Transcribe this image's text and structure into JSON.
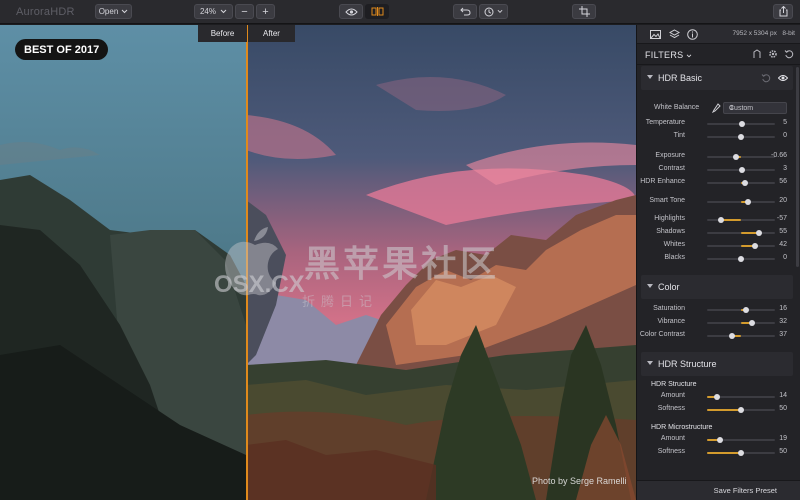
{
  "app": {
    "title": "AuroraHDR"
  },
  "toolbar": {
    "open_label": "Open",
    "zoom_value": "24%",
    "zoom_out_symbol": "−",
    "zoom_in_symbol": "+"
  },
  "canvas": {
    "before_label": "Before",
    "after_label": "After",
    "badge": "BEST OF 2017",
    "photo_credit": "Photo by Serge Ramelli",
    "split_accent_color": "#e08a1c",
    "watermark_logo": {
      "chinese": "黑苹果社区",
      "domain": "OSX.CX",
      "sub": "折腾日记"
    }
  },
  "panel": {
    "image_size": "7952 x 5304 px",
    "bit_depth": "8-bit",
    "filters_title": "FILTERS",
    "accent_color": "#d39b2d",
    "sections": {
      "hdr_basic": {
        "title": "HDR Basic",
        "white_balance_label": "White Balance",
        "white_balance_value": "Custom",
        "rows": [
          {
            "label": "Temperature",
            "value": "5",
            "level": 0.52
          },
          {
            "label": "Tint",
            "value": "0",
            "level": 0.5
          },
          {
            "label": "Exposure",
            "value": "-0.66",
            "level": 0.42
          },
          {
            "label": "Contrast",
            "value": "3",
            "level": 0.51
          },
          {
            "label": "HDR Enhance",
            "value": "56",
            "level": 0.56
          },
          {
            "label": "Smart Tone",
            "value": "20",
            "level": 0.6
          },
          {
            "label": "Highlights",
            "value": "-57",
            "level": 0.21
          },
          {
            "label": "Shadows",
            "value": "55",
            "level": 0.77
          },
          {
            "label": "Whites",
            "value": "42",
            "level": 0.71
          },
          {
            "label": "Blacks",
            "value": "0",
            "level": 0.5
          }
        ]
      },
      "color": {
        "title": "Color",
        "rows": [
          {
            "label": "Saturation",
            "value": "16",
            "level": 0.58
          },
          {
            "label": "Vibrance",
            "value": "32",
            "level": 0.66
          },
          {
            "label": "Color Contrast",
            "value": "37",
            "level": 0.37
          }
        ]
      },
      "hdr_structure": {
        "title": "HDR Structure",
        "group1_title": "HDR Structure",
        "group2_title": "HDR Microstructure",
        "rows": [
          {
            "label": "Amount",
            "value": "14",
            "level": 0.14
          },
          {
            "label": "Softness",
            "value": "50",
            "level": 0.5
          },
          {
            "label": "Amount",
            "value": "19",
            "level": 0.19
          },
          {
            "label": "Softness",
            "value": "50",
            "level": 0.5
          }
        ]
      }
    },
    "save_preset_label": "Save Filters Preset"
  },
  "icons": [
    "chevron-down-icon",
    "eye-icon",
    "compare-icon",
    "undo-icon",
    "history-icon",
    "crop-icon",
    "share-icon",
    "image-icon",
    "layers-icon",
    "info-icon",
    "grid-view-icon",
    "sliders-icon",
    "presets-icon",
    "gear-icon",
    "reset-icon",
    "eyedropper-icon",
    "visibility-icon"
  ]
}
